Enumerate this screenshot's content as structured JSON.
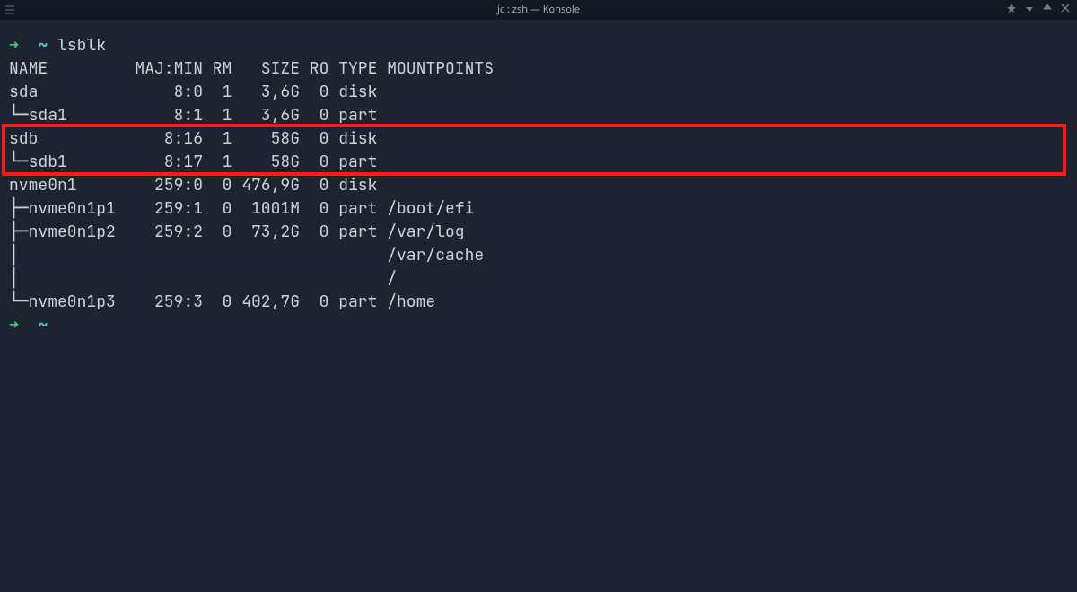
{
  "window": {
    "title": "jc : zsh — Konsole"
  },
  "prompt": {
    "arrow": "➜",
    "tilde": "~",
    "cmd": "lsblk"
  },
  "header": {
    "name": "NAME",
    "majmin": "MAJ:MIN",
    "rm": "RM",
    "size": "SIZE",
    "ro": "RO",
    "type": "TYPE",
    "mount": "MOUNTPOINTS"
  },
  "rows": [
    {
      "tree": "",
      "name": "sda",
      "maj": "8:0",
      "rm": "1",
      "size": "3,6G",
      "ro": "0",
      "type": "disk",
      "mp": ""
    },
    {
      "tree": "└─",
      "name": "sda1",
      "maj": "8:1",
      "rm": "1",
      "size": "3,6G",
      "ro": "0",
      "type": "part",
      "mp": ""
    },
    {
      "tree": "",
      "name": "sdb",
      "maj": "8:16",
      "rm": "1",
      "size": "58G",
      "ro": "0",
      "type": "disk",
      "mp": ""
    },
    {
      "tree": "└─",
      "name": "sdb1",
      "maj": "8:17",
      "rm": "1",
      "size": "58G",
      "ro": "0",
      "type": "part",
      "mp": ""
    },
    {
      "tree": "",
      "name": "nvme0n1",
      "maj": "259:0",
      "rm": "0",
      "size": "476,9G",
      "ro": "0",
      "type": "disk",
      "mp": ""
    },
    {
      "tree": "├─",
      "name": "nvme0n1p1",
      "maj": "259:1",
      "rm": "0",
      "size": "1001M",
      "ro": "0",
      "type": "part",
      "mp": "/boot/efi"
    },
    {
      "tree": "├─",
      "name": "nvme0n1p2",
      "maj": "259:2",
      "rm": "0",
      "size": "73,2G",
      "ro": "0",
      "type": "part",
      "mp": "/var/log"
    },
    {
      "tree": "│ ",
      "name": "",
      "maj": "",
      "rm": "",
      "size": "",
      "ro": "",
      "type": "",
      "mp": "/var/cache"
    },
    {
      "tree": "│ ",
      "name": "",
      "maj": "",
      "rm": "",
      "size": "",
      "ro": "",
      "type": "",
      "mp": "/"
    },
    {
      "tree": "└─",
      "name": "nvme0n1p3",
      "maj": "259:3",
      "rm": "0",
      "size": "402,7G",
      "ro": "0",
      "type": "part",
      "mp": "/home"
    }
  ],
  "cols": {
    "name_w": 12,
    "maj_w": 8,
    "rm_w": 3,
    "size_w": 7,
    "ro_w": 3,
    "type_w": 5
  },
  "highlight": {
    "row_start": 2,
    "row_count": 2
  }
}
